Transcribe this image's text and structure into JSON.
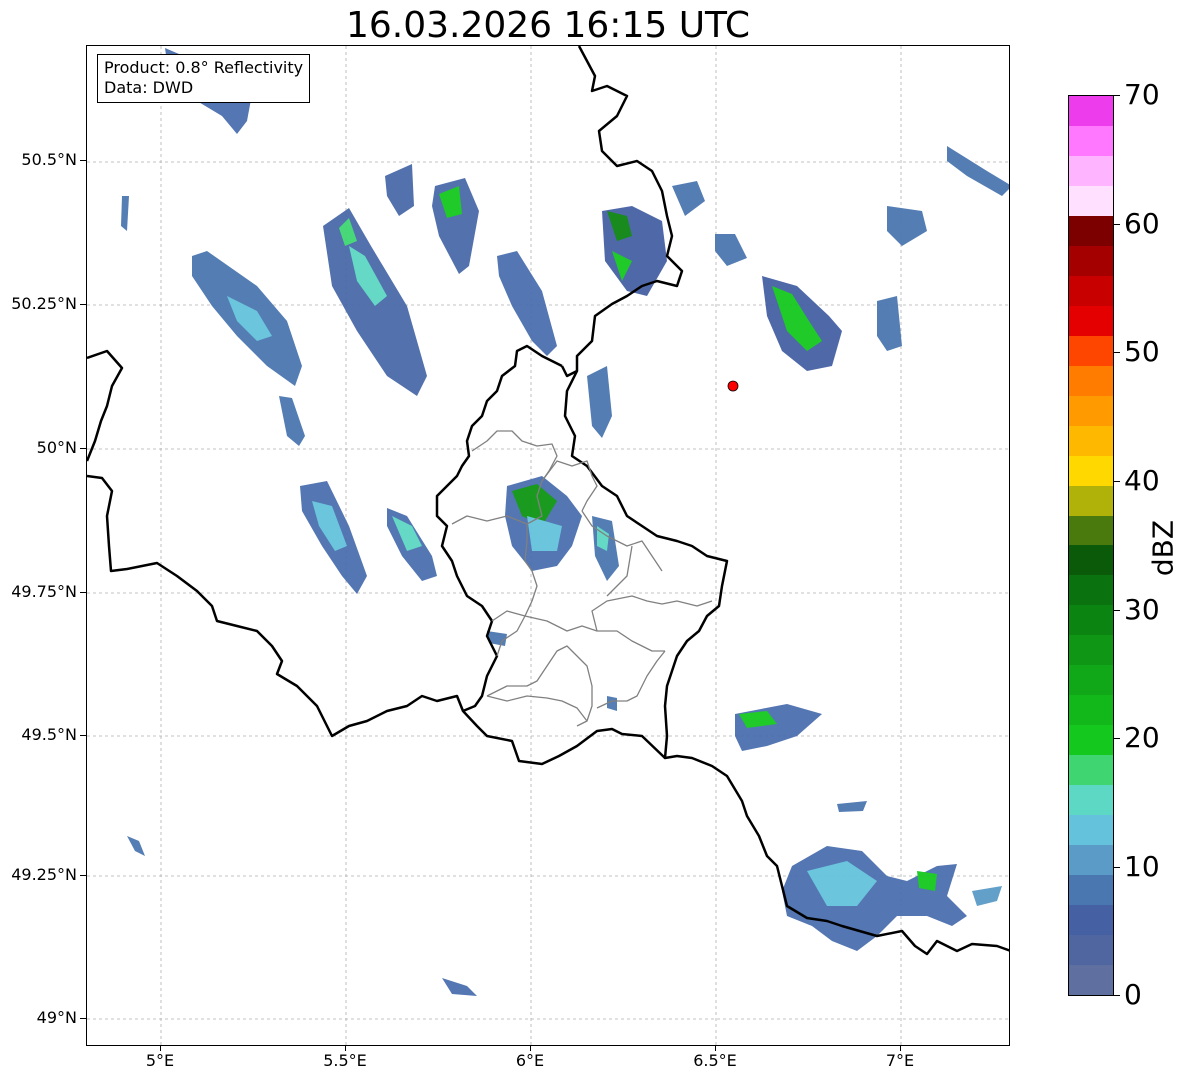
{
  "title": "16.03.2026 16:15 UTC",
  "info": {
    "product": "Product: 0.8° Reflectivity",
    "data": "Data: DWD"
  },
  "lat_ticks": [
    "50.5°N",
    "50.25°N",
    "50°N",
    "49.75°N",
    "49.5°N",
    "49.25°N",
    "49°N"
  ],
  "lon_ticks": [
    "5°E",
    "5.5°E",
    "6°E",
    "6.5°E",
    "7°E"
  ],
  "colorbar": {
    "label": "dBZ",
    "ticks": [
      "70",
      "60",
      "50",
      "40",
      "30",
      "20",
      "10",
      "0"
    ],
    "colors": [
      "#5f6fa0",
      "#4f66a0",
      "#4660a4",
      "#4b77b0",
      "#5a9bc8",
      "#64c2dc",
      "#5dd8c4",
      "#3fd672",
      "#14c81e",
      "#12b81a",
      "#10a818",
      "#0e9614",
      "#0c8412",
      "#0a720e",
      "#0a5a0a",
      "#4a7a0e",
      "#b0b20a",
      "#ffd800",
      "#ffb800",
      "#ff9a00",
      "#ff7c00",
      "#ff4600",
      "#e40000",
      "#c80000",
      "#a50000",
      "#7c0000",
      "#ffe0ff",
      "#ffb4ff",
      "#ff78ff",
      "#ec3cec"
    ]
  },
  "radar_site": {
    "lon": 6.547,
    "lat": 50.11,
    "color": "#ff0000"
  }
}
